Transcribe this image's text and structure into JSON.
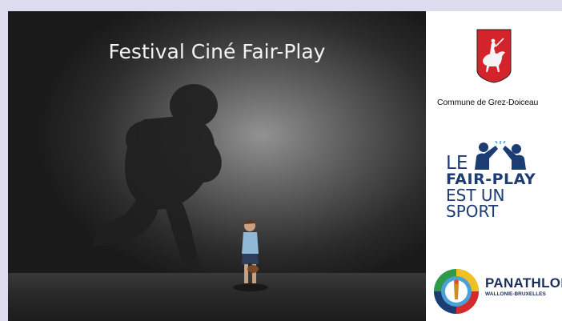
{
  "slide": {
    "title": "Festival Ciné Fair-Play"
  },
  "logos": {
    "commune": {
      "name": "Commune de Grez-Doiceau",
      "icon": "knight-on-horse-crest-icon"
    },
    "fairplay": {
      "line1": "LE",
      "line2": "FAIR-PLAY",
      "line3": "EST UN",
      "line4": "SPORT",
      "icon": "high-five-figures-icon"
    },
    "panathlon": {
      "name": "PANATHLON",
      "subtitle": "WALLONIE-BRUXELLES",
      "icon": "panathlon-emblem-icon"
    }
  },
  "colors": {
    "brand_navy": "#1c3d73",
    "crest_red": "#d4232b"
  }
}
